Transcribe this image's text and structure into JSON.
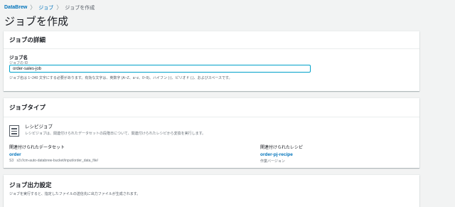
{
  "breadcrumb": {
    "root": "DataBrew",
    "sep": "〉",
    "middle": "ジョブ",
    "current": "ジョブを作成"
  },
  "page_title": "ジョブを作成",
  "details": {
    "header": "ジョブの詳細",
    "name_label": "ジョブ名",
    "name_sublabel": "ジョブの ID",
    "name_value": "order-sales-job",
    "hint": "ジョブ名は 1~240 文字にする必要があります。有効な文字は、英数字 (A~Z、a~z、0~9)、ハイフン (-)、ピリオド (.)、およびスペースです。"
  },
  "job_type": {
    "header": "ジョブタイプ",
    "recipe_title": "レシピジョブ",
    "recipe_desc": "レシピジョブは、関連付けられたデータセットの段階日について、関連付けられたレシピから変換を実行します。",
    "dataset_label": "関連付けられたデータセット",
    "dataset_name": "order",
    "dataset_badge": "S3",
    "dataset_path": "s3://cm-auto-databrew-bucket/input/order_data_file/",
    "recipe_label": "関連付けられたレシピ",
    "recipe_name": "order-pj-recipe",
    "recipe_version_label": "作業バージョン"
  },
  "output": {
    "header": "ジョブ出力設定",
    "desc": "ジョブを実行すると、指定したファイルの送信先に出力ファイルが生成されます。"
  }
}
